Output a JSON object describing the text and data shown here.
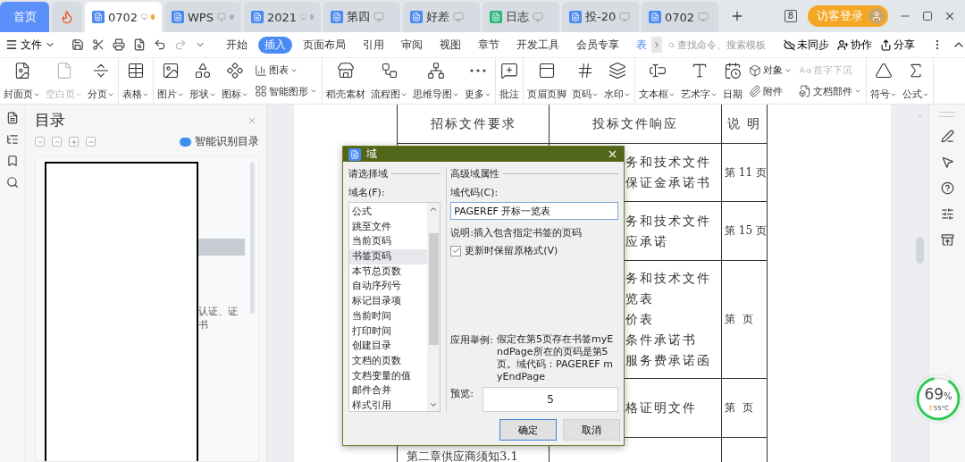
{
  "tabs": [
    {
      "kind": "home",
      "label": "首页",
      "selected": false
    },
    {
      "kind": "app",
      "selected": false
    },
    {
      "kind": "doc",
      "label": "0702",
      "selected": true,
      "unsaved": true
    },
    {
      "kind": "doc",
      "label": "WPS",
      "selected": false,
      "unsaved": true
    },
    {
      "kind": "doc",
      "label": "2021",
      "selected": false,
      "unsaved": true
    },
    {
      "kind": "doc",
      "label": "第四",
      "selected": false,
      "unsaved": false
    },
    {
      "kind": "doc",
      "label": "好差",
      "selected": false,
      "unsaved": false
    },
    {
      "kind": "sheet",
      "label": "日志",
      "selected": false,
      "unsaved": false
    },
    {
      "kind": "doc",
      "label": "投-20",
      "selected": false,
      "unsaved": false
    },
    {
      "kind": "doc",
      "label": "0702",
      "selected": false,
      "unsaved": false
    }
  ],
  "window_count": "8",
  "login": "访客登录",
  "menu": {
    "file": "文件",
    "ribbon_tabs": [
      {
        "label": "开始",
        "selected": false
      },
      {
        "label": "插入",
        "selected": true
      },
      {
        "label": "页面布局",
        "selected": false
      },
      {
        "label": "引用",
        "selected": false
      },
      {
        "label": "审阅",
        "selected": false
      },
      {
        "label": "视图",
        "selected": false
      },
      {
        "label": "章节",
        "selected": false
      },
      {
        "label": "开发工具",
        "selected": false
      },
      {
        "label": "会员专享",
        "selected": false
      },
      {
        "label": "表",
        "selected": false
      }
    ],
    "search": {
      "placeholder": "查找命令、搜索模板"
    },
    "actions": [
      "未同步",
      "协作",
      "分享"
    ]
  },
  "ribbon": {
    "groups": [
      {
        "items": [
          {
            "kind": "large",
            "label": "封面页",
            "caret": true,
            "disabled": false
          },
          {
            "kind": "large",
            "label": "空白页",
            "caret": true,
            "disabled": true
          },
          {
            "kind": "large",
            "label": "分页",
            "caret": true,
            "disabled": false
          }
        ]
      },
      {
        "items": [
          {
            "kind": "large",
            "label": "表格",
            "caret": true,
            "disabled": false
          }
        ]
      },
      {
        "items": [
          {
            "kind": "large",
            "label": "图片",
            "caret": true,
            "disabled": false
          },
          {
            "kind": "large",
            "label": "形状",
            "caret": true,
            "disabled": false
          },
          {
            "kind": "large",
            "label": "图标",
            "caret": true,
            "disabled": false
          },
          {
            "kind": "stack",
            "items": [
              {
                "label": "图表",
                "caret": true,
                "disabled": false
              },
              {
                "label": "智能图形",
                "caret": true,
                "disabled": false
              }
            ]
          }
        ]
      },
      {
        "items": [
          {
            "kind": "large",
            "label": "稻壳素材",
            "caret": false,
            "disabled": false
          },
          {
            "kind": "large",
            "label": "流程图",
            "caret": true,
            "disabled": false
          },
          {
            "kind": "large",
            "label": "思维导图",
            "caret": true,
            "disabled": false
          },
          {
            "kind": "large",
            "label": "更多",
            "caret": true,
            "disabled": false
          }
        ]
      },
      {
        "items": [
          {
            "kind": "large",
            "label": "批注",
            "caret": false,
            "disabled": false
          }
        ]
      },
      {
        "items": [
          {
            "kind": "large",
            "label": "页眉页脚",
            "caret": false,
            "disabled": false
          },
          {
            "kind": "large",
            "label": "页码",
            "caret": true,
            "disabled": false
          },
          {
            "kind": "large",
            "label": "水印",
            "caret": true,
            "disabled": false
          }
        ]
      },
      {
        "items": [
          {
            "kind": "large",
            "label": "文本框",
            "caret": true,
            "disabled": false
          },
          {
            "kind": "large",
            "label": "艺术字",
            "caret": true,
            "disabled": false
          },
          {
            "kind": "large",
            "label": "日期",
            "caret": false,
            "disabled": false
          },
          {
            "kind": "stack",
            "items": [
              {
                "label": "对象",
                "caret": true,
                "disabled": false
              },
              {
                "label": "附件",
                "caret": false,
                "disabled": false
              }
            ]
          },
          {
            "kind": "stack",
            "items": [
              {
                "label": "首字下沉",
                "caret": false,
                "disabled": true
              },
              {
                "label": "文档部件",
                "caret": true,
                "disabled": false
              }
            ]
          }
        ]
      },
      {
        "items": [
          {
            "kind": "large",
            "label": "符号",
            "caret": true,
            "disabled": false
          },
          {
            "kind": "large",
            "label": "公式",
            "caret": true,
            "disabled": false
          }
        ]
      }
    ]
  },
  "nav": {
    "title": "目录",
    "smart": "智能识别目录",
    "fragment": "认证、证书"
  },
  "table": {
    "header": [
      "招标文件要求",
      "投标文件响应",
      "说 明"
    ],
    "rows": [
      {
        "response": [
          "务和技术文件",
          "保证金承诺书"
        ],
        "note": "第 11 页"
      },
      {
        "response": [
          "务和技术文件",
          "应承诺"
        ],
        "note": "第 15 页"
      },
      {
        "response": [
          "务和技术文件",
          "览表",
          "价表",
          "条件承诺书",
          "服务费承诺函"
        ],
        "note": "第  页"
      },
      {
        "response": [
          "格证明文件"
        ],
        "note": "第  页"
      },
      {
        "requirement": "第二章供应商须知3.1"
      }
    ]
  },
  "dialog": {
    "title": "域",
    "left_group": "请选择域",
    "list_label": "域名(F):",
    "fields": [
      {
        "label": "公式",
        "selected": false
      },
      {
        "label": "跳至文件",
        "selected": false
      },
      {
        "label": "当前页码",
        "selected": false
      },
      {
        "label": "书签页码",
        "selected": true
      },
      {
        "label": "本节总页数",
        "selected": false
      },
      {
        "label": "自动序列号",
        "selected": false
      },
      {
        "label": "标记目录项",
        "selected": false
      },
      {
        "label": "当前时间",
        "selected": false
      },
      {
        "label": "打印时间",
        "selected": false
      },
      {
        "label": "创建目录",
        "selected": false
      },
      {
        "label": "文档的页数",
        "selected": false
      },
      {
        "label": "文档变量的值",
        "selected": false
      },
      {
        "label": "邮件合并",
        "selected": false
      },
      {
        "label": "样式引用",
        "selected": false
      }
    ],
    "right_group": "高级域属性",
    "code_label": "域代码(C):",
    "code_value": "PAGEREF 开标一览表",
    "description": "说明:插入包含指定书签的页码",
    "keep_format": {
      "label": "更新时保留原格式(V)",
      "checked": true
    },
    "example_label": "应用举例:",
    "example": "假定在第5页存在书签myEndPage所在的页码是第5页。域代码：PAGEREF myEndPage",
    "preview_label": "预览:",
    "preview": "5",
    "buttons": [
      {
        "label": "确定",
        "default": true
      },
      {
        "label": "取消",
        "default": false
      }
    ]
  },
  "meter": {
    "percent": "69",
    "unit": "%",
    "temp": "55°C"
  }
}
